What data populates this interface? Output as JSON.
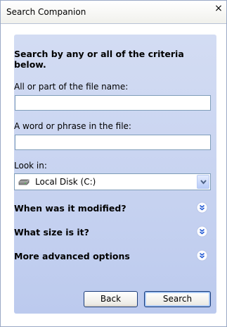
{
  "window": {
    "title": "Search Companion",
    "close_glyph": "×"
  },
  "form": {
    "heading": "Search by any or all of the criteria below.",
    "file_name": {
      "label": "All or part of the file name:",
      "value": "",
      "placeholder": ""
    },
    "phrase": {
      "label": "A word or phrase in the file:",
      "value": "",
      "placeholder": ""
    },
    "look_in": {
      "label": "Look in:",
      "value": "Local Disk (C:)",
      "icon": "hard-drive-icon"
    }
  },
  "sections": [
    {
      "label": "When was it modified?",
      "icon": "expand-chevron-icon"
    },
    {
      "label": "What size is it?",
      "icon": "expand-chevron-icon"
    },
    {
      "label": "More advanced options",
      "icon": "expand-chevron-icon"
    }
  ],
  "buttons": {
    "back": "Back",
    "search": "Search"
  },
  "colors": {
    "panel": "#c6d2f0",
    "chevron": "#2159d4",
    "field_border": "#7f9db9"
  }
}
